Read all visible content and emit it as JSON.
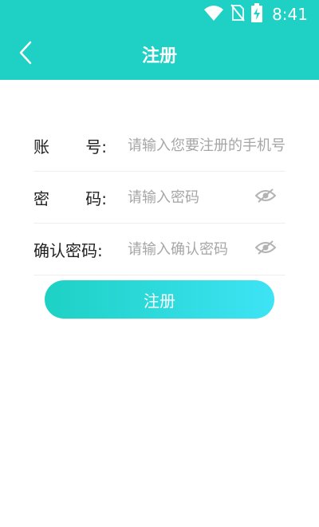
{
  "status_bar": {
    "time": "8:41"
  },
  "nav": {
    "title": "注册"
  },
  "form": {
    "account": {
      "label_a": "账",
      "label_b": "号:",
      "placeholder": "请输入您要注册的手机号"
    },
    "password": {
      "label_a": "密",
      "label_b": "码:",
      "placeholder": "请输入密码"
    },
    "confirm": {
      "label": "确认密码:",
      "placeholder": "请输入确认密码"
    }
  },
  "submit": {
    "label": "注册"
  },
  "colors": {
    "primary": "#1fd1c4",
    "gradient_end": "#3ee3f5",
    "placeholder": "#a6a6a6"
  },
  "icons": [
    "back-arrow-icon",
    "wifi-icon",
    "no-sim-icon",
    "battery-charging-icon",
    "eye-hidden-icon"
  ]
}
